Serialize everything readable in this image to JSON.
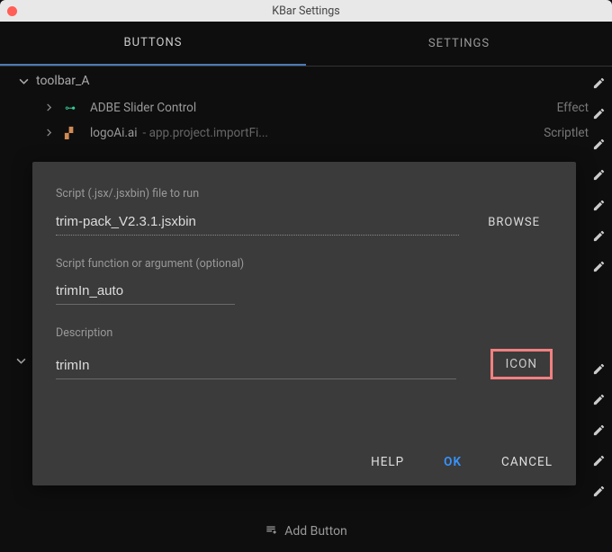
{
  "window": {
    "title": "KBar Settings"
  },
  "tabs": {
    "buttons": "BUTTONS",
    "settings": "SETTINGS"
  },
  "sections": [
    {
      "name": "toolbar_A"
    }
  ],
  "rows": [
    {
      "label": "ADBE Slider Control",
      "extra": "",
      "type": "Effect"
    },
    {
      "label": "logoAi.ai",
      "extra": " - app.project.importFi...",
      "type": "Scriptlet"
    }
  ],
  "modal": {
    "script_label": "Script (.jsx/.jsxbin) file to run",
    "script_value": "trim-pack_V2.3.1.jsxbin",
    "browse": "BROWSE",
    "func_label": "Script function or argument (optional)",
    "func_value": "trimIn_auto",
    "desc_label": "Description",
    "desc_value": "trimIn",
    "icon": "ICON",
    "help": "HELP",
    "ok": "OK",
    "cancel": "CANCEL"
  },
  "footer": {
    "add": "Add Button"
  }
}
